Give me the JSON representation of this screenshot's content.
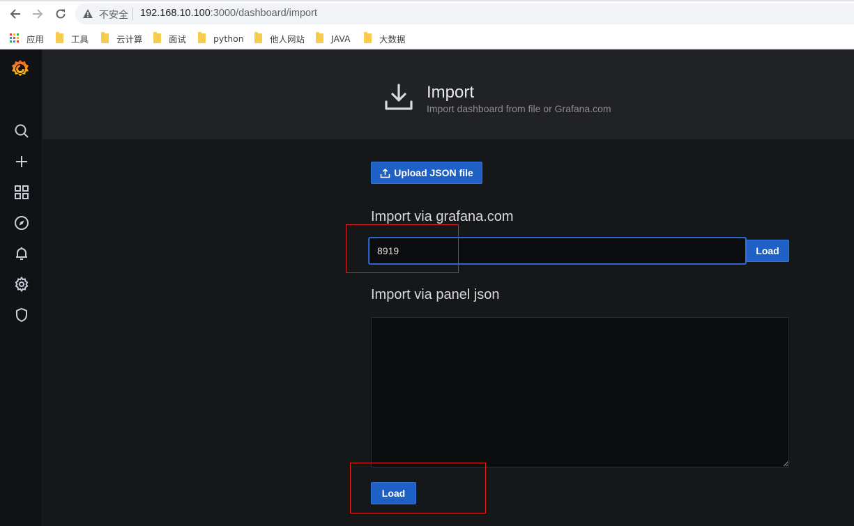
{
  "browser": {
    "security_label": "不安全",
    "url_host": "192.168.10.100",
    "url_rest": ":3000/dashboard/import",
    "bookmarks": [
      {
        "label": "应用",
        "icon": "apps-grid-icon"
      },
      {
        "label": "工具",
        "icon": "folder-icon"
      },
      {
        "label": "云计算",
        "icon": "folder-icon"
      },
      {
        "label": "面试",
        "icon": "folder-icon"
      },
      {
        "label": "python",
        "icon": "folder-icon"
      },
      {
        "label": "他人网站",
        "icon": "folder-icon"
      },
      {
        "label": "JAVA",
        "icon": "folder-icon"
      },
      {
        "label": "大数据",
        "icon": "folder-icon"
      }
    ]
  },
  "sidemenu": {
    "items": [
      "search-icon",
      "plus-icon",
      "dashboards-grid-icon",
      "explore-compass-icon",
      "alerting-bell-icon",
      "configuration-gear-icon",
      "server-admin-shield-icon"
    ]
  },
  "header": {
    "title": "Import",
    "subtitle": "Import dashboard from file or Grafana.com"
  },
  "upload": {
    "label": "Upload JSON file"
  },
  "grafana_com": {
    "title": "Import via grafana.com",
    "input_value": "8919",
    "load_label": "Load"
  },
  "panel_json": {
    "title": "Import via panel json",
    "textarea_value": "",
    "load_label": "Load"
  },
  "colors": {
    "primary": "#1f60c4",
    "annotation_red": "#e02020",
    "grafana_orange": "#f05a28"
  }
}
